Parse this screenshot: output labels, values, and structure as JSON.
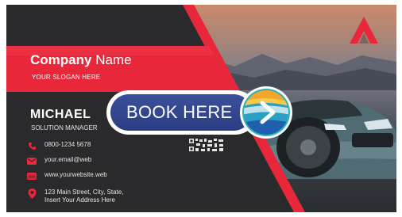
{
  "card": {
    "company_bold": "Company",
    "company_rest": "Name",
    "slogan": "YOUR SLOGAN HERE",
    "name": "MICHAEL",
    "role": "SOLUTION MANAGER",
    "phone": "0800-1234 5678",
    "email": "your.email@web",
    "website": "www.yourwebsite.web",
    "address_line1": "123 Main Street, City, State,",
    "address_line2": "Insert Your Address Here"
  },
  "cta": {
    "label": "BOOK HERE",
    "icon": "chevron-right-icon"
  },
  "colors": {
    "accent_red": "#e8273a",
    "dark": "#2a2a2c",
    "button_blue": "#2f4189",
    "teal": "#2bb3b8"
  }
}
